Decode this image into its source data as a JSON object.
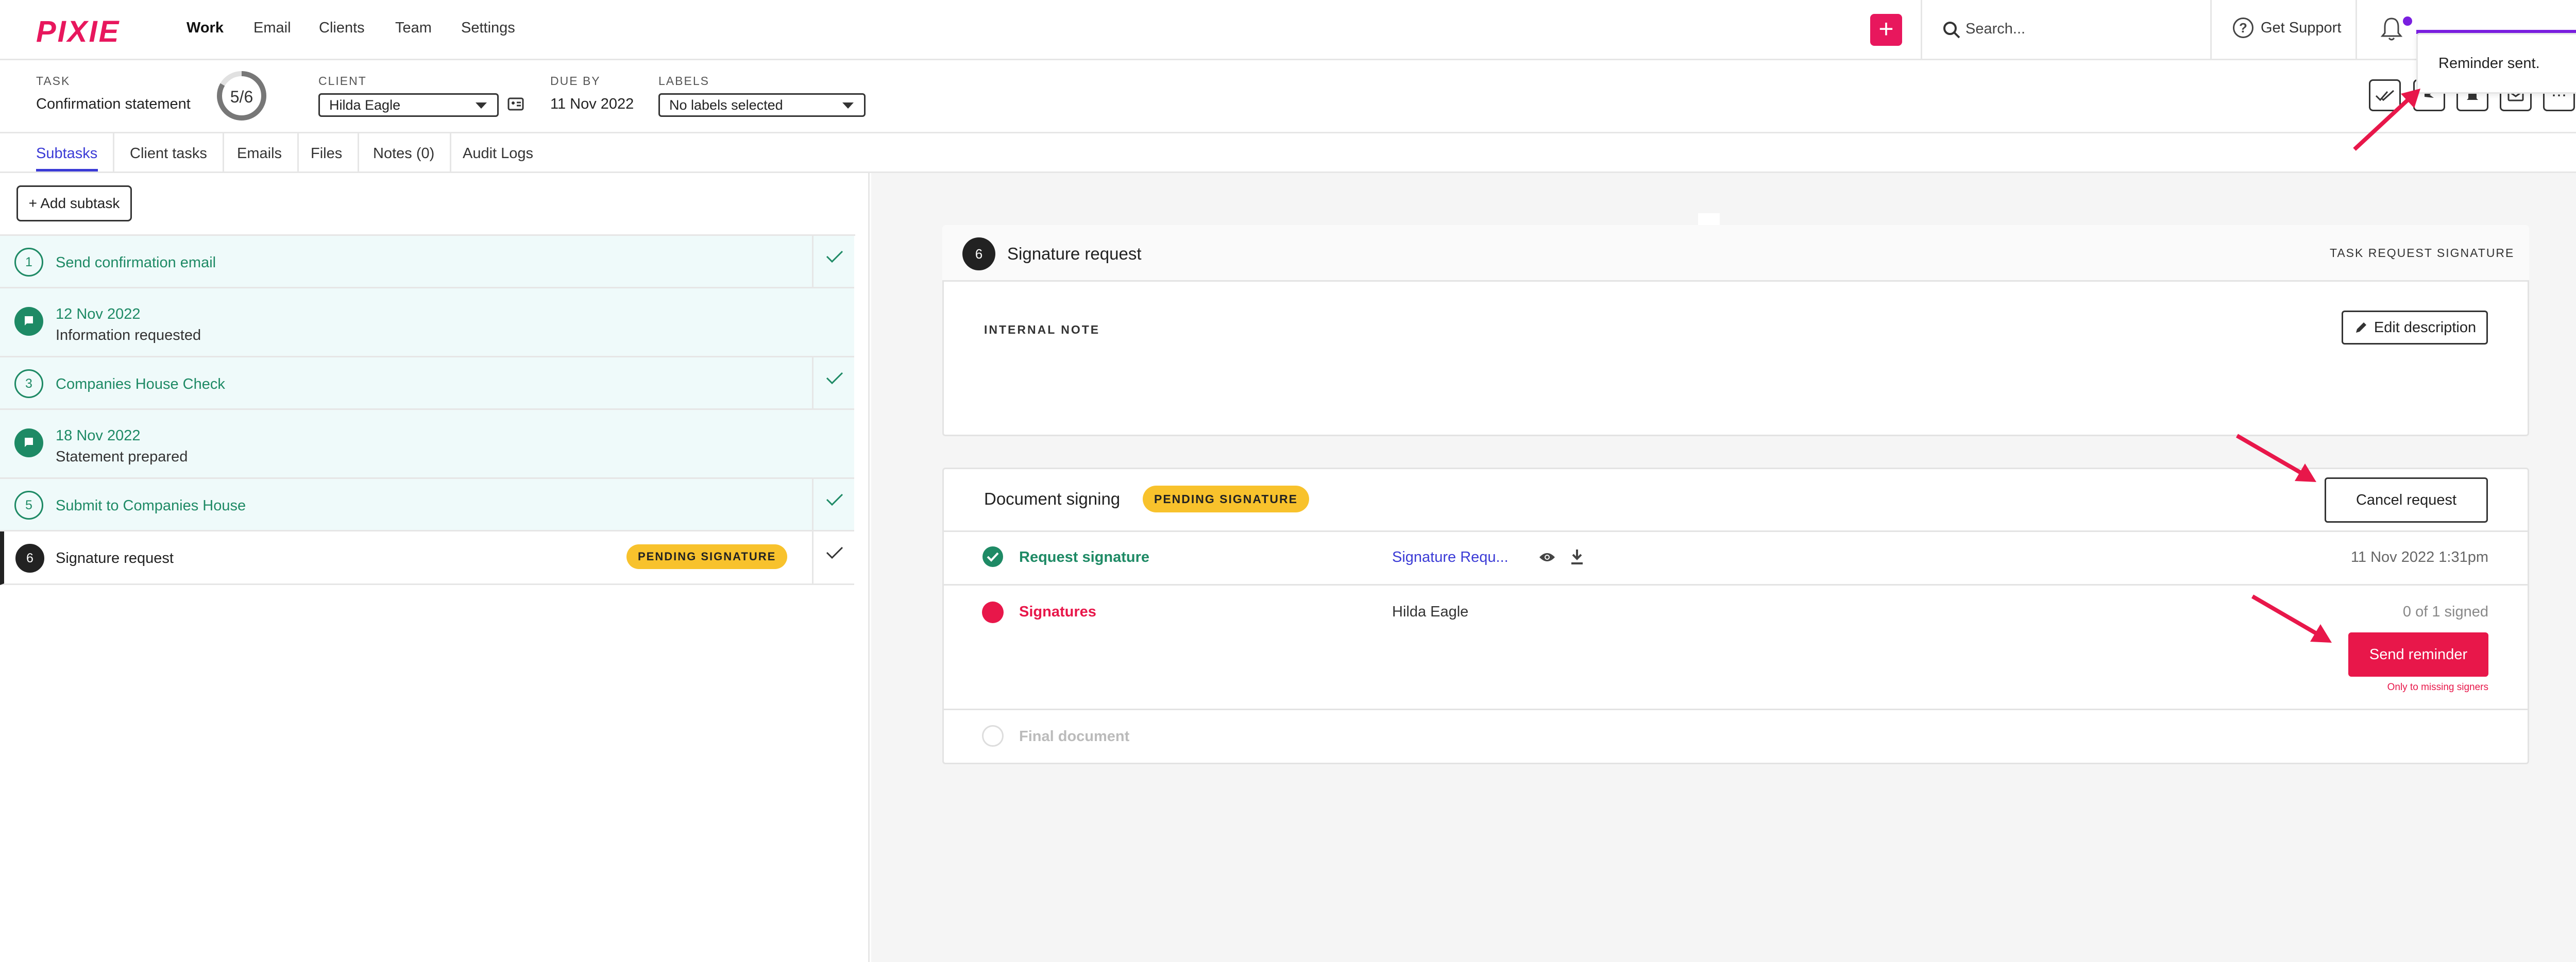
{
  "app": {
    "logo": "PIXIE"
  },
  "nav": {
    "items": [
      "Work",
      "Email",
      "Clients",
      "Team",
      "Settings"
    ],
    "active": "Work"
  },
  "search": {
    "placeholder": "Search..."
  },
  "support": {
    "label": "Get Support"
  },
  "colors": {
    "brand": "#e8175d",
    "accent": "#3b3bd6",
    "success": "#1e8a65",
    "badge": "#f8c22c",
    "notify": "#7a1fe0"
  },
  "task": {
    "label": "TASK",
    "name": "Confirmation statement",
    "progress": {
      "done": 5,
      "total": 6,
      "text": "5/6"
    },
    "client_label": "CLIENT",
    "client": "Hilda Eagle",
    "due_label": "DUE BY",
    "due": "11 Nov 2022",
    "labels_label": "LABELS",
    "labels_value": "No labels selected"
  },
  "toast": {
    "message": "Reminder sent."
  },
  "tabs": [
    "Subtasks",
    "Client tasks",
    "Emails",
    "Files",
    "Notes (0)",
    "Audit Logs"
  ],
  "left": {
    "add_subtask": "+ Add subtask",
    "rows": [
      {
        "num": "1",
        "title": "Send confirmation email",
        "checked": true
      },
      {
        "date": "12 Nov 2022",
        "note": "Information requested"
      },
      {
        "num": "3",
        "title": "Companies House Check",
        "checked": true
      },
      {
        "date": "18 Nov 2022",
        "note": "Statement prepared"
      },
      {
        "num": "5",
        "title": "Submit to Companies House",
        "checked": true
      },
      {
        "num": "6",
        "title": "Signature request",
        "badge": "PENDING SIGNATURE",
        "checked": true
      }
    ]
  },
  "detail": {
    "num": "6",
    "title": "Signature request",
    "type": "TASK REQUEST SIGNATURE",
    "internal_note": "INTERNAL NOTE",
    "edit_description": "Edit description"
  },
  "signing": {
    "title": "Document signing",
    "badge": "PENDING SIGNATURE",
    "cancel": "Cancel request",
    "request": {
      "label": "Request signature",
      "file": "Signature Requ...",
      "time": "11 Nov 2022 1:31pm"
    },
    "signatures": {
      "label": "Signatures",
      "signer": "Hilda Eagle",
      "count": "0 of 1 signed",
      "send": "Send reminder",
      "hint": "Only to missing signers"
    },
    "final": {
      "label": "Final document"
    }
  }
}
